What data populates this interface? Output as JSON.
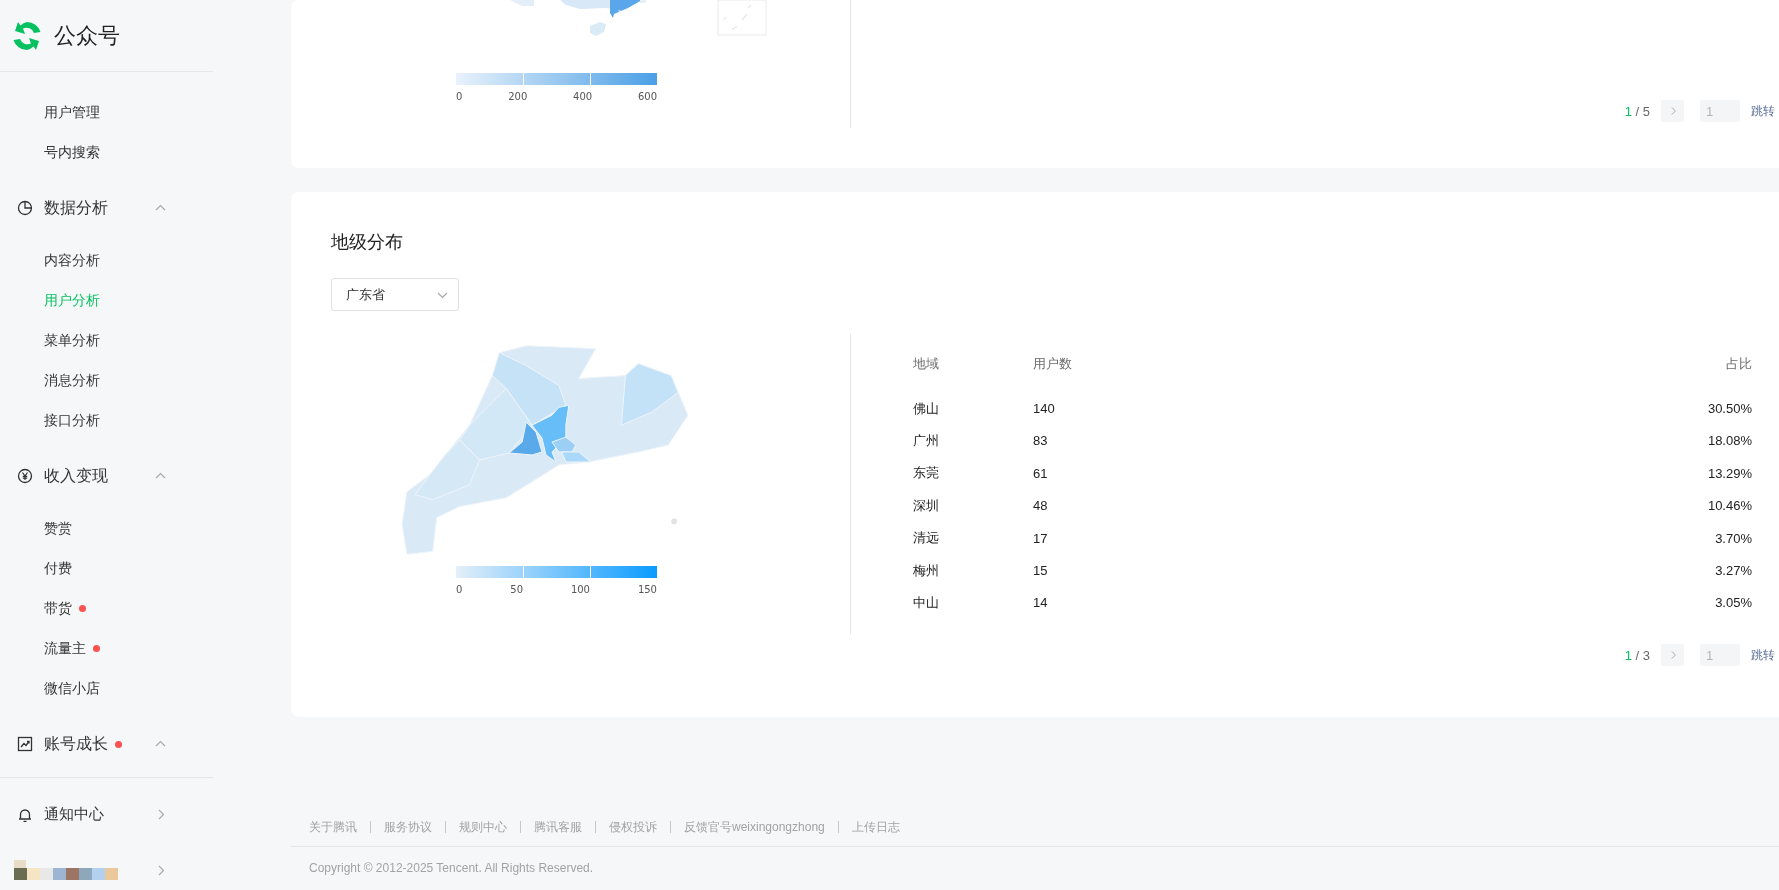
{
  "app": {
    "name": "公众号"
  },
  "sidebar": {
    "sections": [
      {
        "kind": "list",
        "items": [
          {
            "label": "用户管理",
            "selected": false,
            "badge": false
          },
          {
            "label": "号内搜索",
            "selected": false,
            "badge": false
          }
        ]
      },
      {
        "kind": "group",
        "label": "数据分析",
        "badge": false,
        "expanded": true,
        "items": [
          {
            "label": "内容分析",
            "selected": false,
            "badge": false
          },
          {
            "label": "用户分析",
            "selected": true,
            "badge": false
          },
          {
            "label": "菜单分析",
            "selected": false,
            "badge": false
          },
          {
            "label": "消息分析",
            "selected": false,
            "badge": false
          },
          {
            "label": "接口分析",
            "selected": false,
            "badge": false
          }
        ]
      },
      {
        "kind": "group",
        "label": "收入变现",
        "badge": false,
        "expanded": true,
        "items": [
          {
            "label": "赞赏",
            "selected": false,
            "badge": false
          },
          {
            "label": "付费",
            "selected": false,
            "badge": false
          },
          {
            "label": "带货",
            "selected": false,
            "badge": true
          },
          {
            "label": "流量主",
            "selected": false,
            "badge": true
          },
          {
            "label": "微信小店",
            "selected": false,
            "badge": false
          }
        ]
      },
      {
        "kind": "group",
        "label": "账号成长",
        "badge": true,
        "expanded": true
      },
      {
        "kind": "link",
        "label": "通知中心"
      },
      {
        "kind": "account"
      }
    ]
  },
  "top_card": {
    "legend_ticks": [
      "0",
      "200",
      "400",
      "600"
    ],
    "pagination": {
      "current": "1",
      "separator": "/",
      "total": "5",
      "page_placeholder": "1",
      "jump": "跳转"
    }
  },
  "city_card": {
    "title": "地级分布",
    "province_select": {
      "value": "广东省"
    },
    "legend_ticks": [
      "0",
      "50",
      "100",
      "150"
    ],
    "table": {
      "columns": [
        "地域",
        "用户数",
        "占比"
      ],
      "rows": [
        [
          "佛山",
          "140",
          "30.50%"
        ],
        [
          "广州",
          "83",
          "18.08%"
        ],
        [
          "东莞",
          "61",
          "13.29%"
        ],
        [
          "深圳",
          "48",
          "10.46%"
        ],
        [
          "清远",
          "17",
          "3.70%"
        ],
        [
          "梅州",
          "15",
          "3.27%"
        ],
        [
          "中山",
          "14",
          "3.05%"
        ]
      ]
    },
    "pagination": {
      "current": "1",
      "separator": "/",
      "total": "3",
      "page_placeholder": "1",
      "jump": "跳转"
    }
  },
  "footer": {
    "links": [
      "关于腾讯",
      "服务协议",
      "规则中心",
      "腾讯客服",
      "侵权投诉",
      "反馈官号weixingongzhong",
      "上传日志"
    ],
    "copyright": "Copyright © 2012-2025 Tencent. All Rights Reserved."
  }
}
